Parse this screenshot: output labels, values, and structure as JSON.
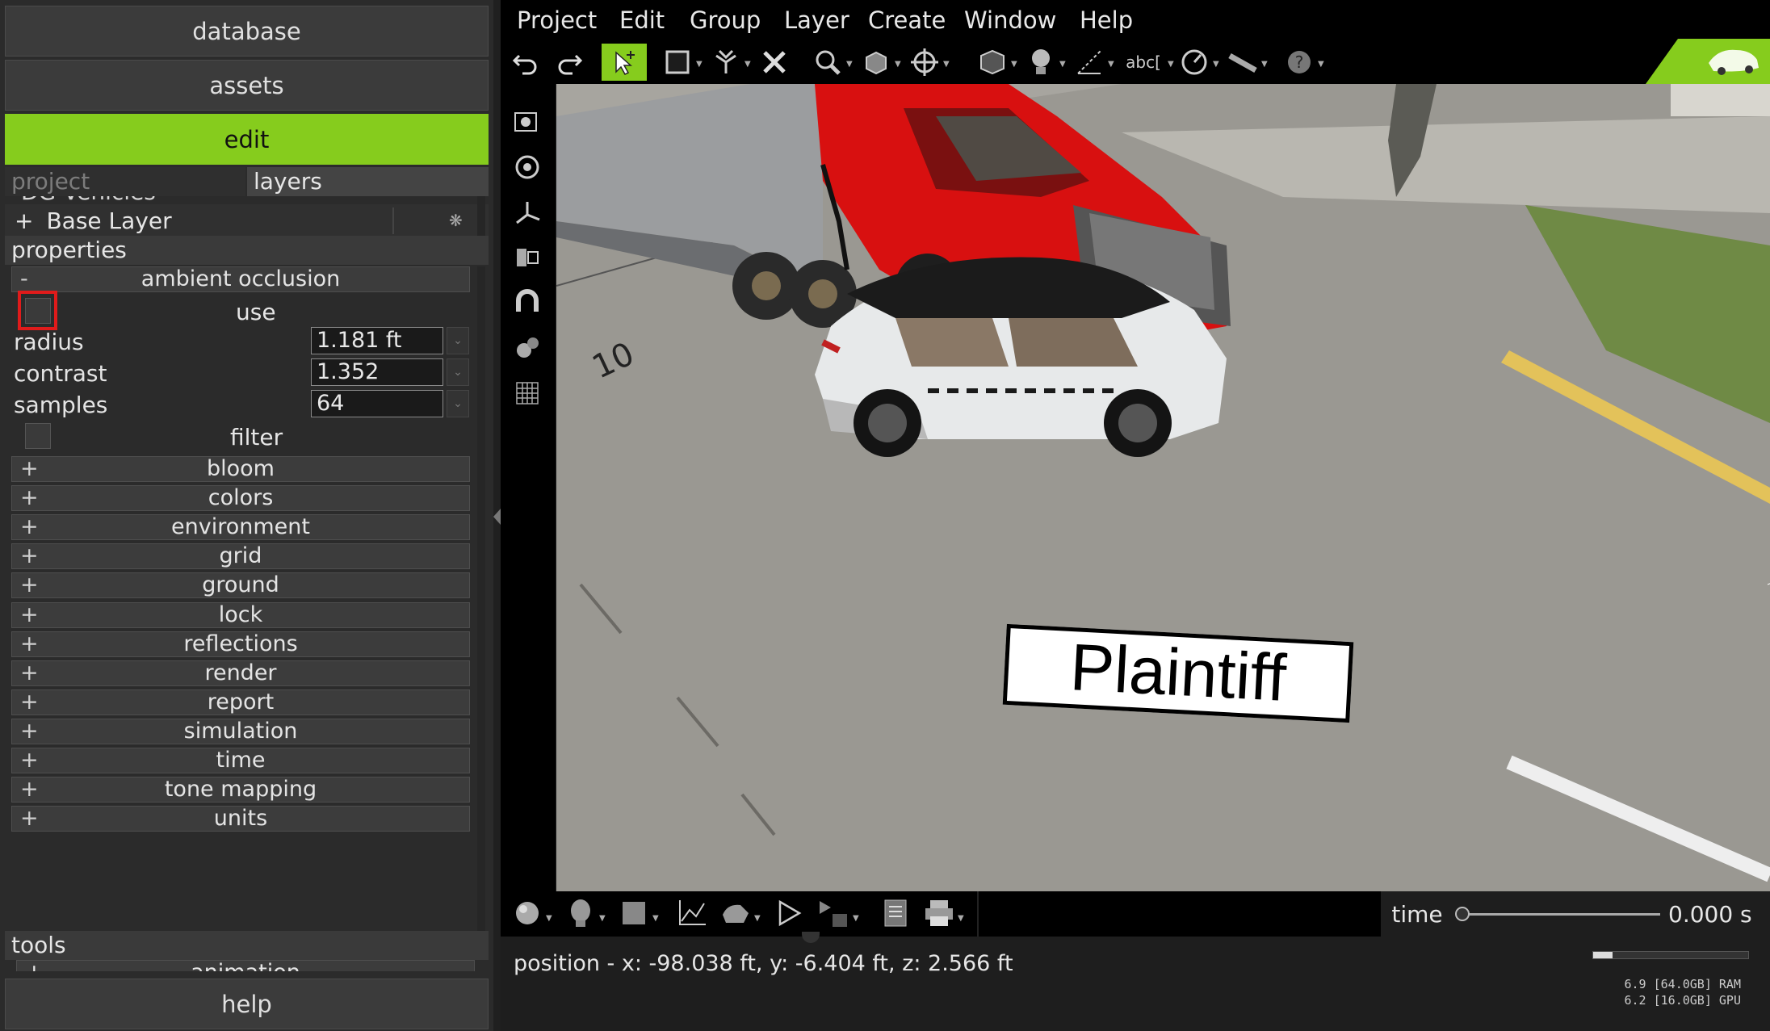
{
  "nav": {
    "database": "database",
    "assets": "assets",
    "edit": "edit",
    "help": "help"
  },
  "subtabs": {
    "project": "project",
    "layers": "layers"
  },
  "layers": {
    "partial_item": "DG Vehicles",
    "base_layer": "Base Layer",
    "expand": "+"
  },
  "properties": {
    "header": "properties",
    "ambient_occlusion": {
      "title": "ambient occlusion",
      "collapse": "-",
      "use_label": "use",
      "use_checked": false,
      "radius_label": "radius",
      "radius_value": "1.181 ft",
      "contrast_label": "contrast",
      "contrast_value": "1.352",
      "samples_label": "samples",
      "samples_value": "64",
      "filter_label": "filter",
      "filter_checked": false
    },
    "groups": [
      "bloom",
      "colors",
      "environment",
      "grid",
      "ground",
      "lock",
      "reflections",
      "render",
      "report",
      "simulation",
      "time",
      "tone mapping",
      "units"
    ],
    "expand_symbol": "+"
  },
  "tools": {
    "header": "tools",
    "partial_item": "animation"
  },
  "menu": [
    "Project",
    "Edit",
    "Group",
    "Layer",
    "Create",
    "Window",
    "Help"
  ],
  "toolbar": {
    "text_tool": "abc["
  },
  "viewport": {
    "label_text": "Plaintiff",
    "axis_label": "10"
  },
  "timeline": {
    "label": "time",
    "value": "0.000 s",
    "position": 0.0
  },
  "status": {
    "position": "position - x: -98.038 ft, y: -6.404 ft, z: 2.566 ft",
    "ram": "6.9 [64.0GB] RAM",
    "gpu": "6.2 [16.0GB] GPU"
  },
  "colors": {
    "accent": "#86cc1d",
    "highlight_box": "#e01b1b"
  }
}
